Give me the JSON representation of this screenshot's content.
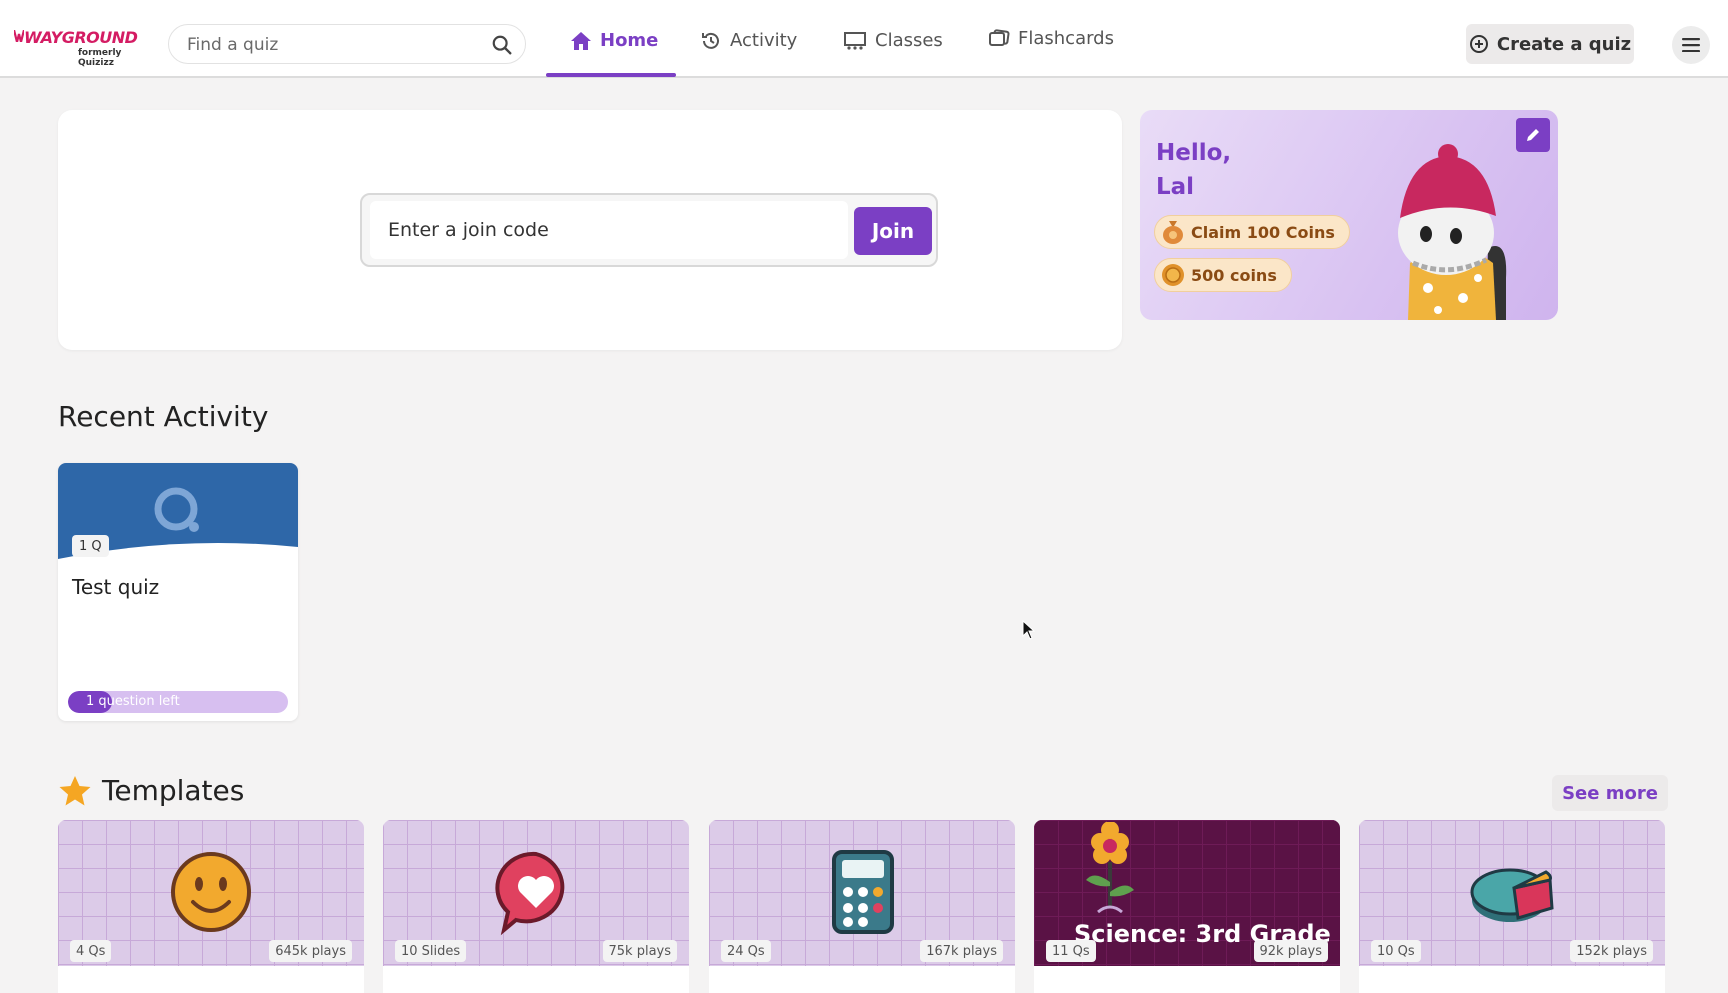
{
  "header": {
    "logo": "WAYGROUND",
    "logo_sub": "formerly Quizizz",
    "search_placeholder": "Find a quiz",
    "tabs": [
      {
        "label": "Home",
        "icon": "home-icon",
        "active": true
      },
      {
        "label": "Activity",
        "icon": "history-icon",
        "active": false
      },
      {
        "label": "Classes",
        "icon": "classes-icon",
        "active": false
      },
      {
        "label": "Flashcards",
        "icon": "flashcards-icon",
        "active": false
      }
    ],
    "create_label": "Create a quiz"
  },
  "join": {
    "placeholder": "Enter a join code",
    "button": "Join"
  },
  "profile": {
    "greeting": "Hello,",
    "name": "Lal",
    "claim_label": "Claim 100 Coins",
    "coins_label": "500 coins"
  },
  "recent": {
    "title": "Recent Activity",
    "items": [
      {
        "title": "Test quiz",
        "badge": "1 Q",
        "progress_label": "1 question left",
        "progress": 0.2
      }
    ]
  },
  "templates": {
    "title": "Templates",
    "see_more": "See more",
    "items": [
      {
        "left_badge": "4 Qs",
        "plays": "645k plays",
        "art": "smiley-icon"
      },
      {
        "left_badge": "10 Slides",
        "plays": "75k plays",
        "art": "heart-bubble-icon"
      },
      {
        "left_badge": "24 Qs",
        "plays": "167k plays",
        "art": "calculator-icon"
      },
      {
        "left_badge": "11 Qs",
        "plays": "92k plays",
        "art": "flower-icon",
        "cover_title": "Science: 3rd Grade"
      },
      {
        "left_badge": "10 Qs",
        "plays": "152k plays",
        "art": "pie-chart-icon"
      }
    ]
  },
  "colors": {
    "accent": "#7b3fc4",
    "brand": "#d41c63",
    "quiz_cover": "#2e67a8"
  }
}
